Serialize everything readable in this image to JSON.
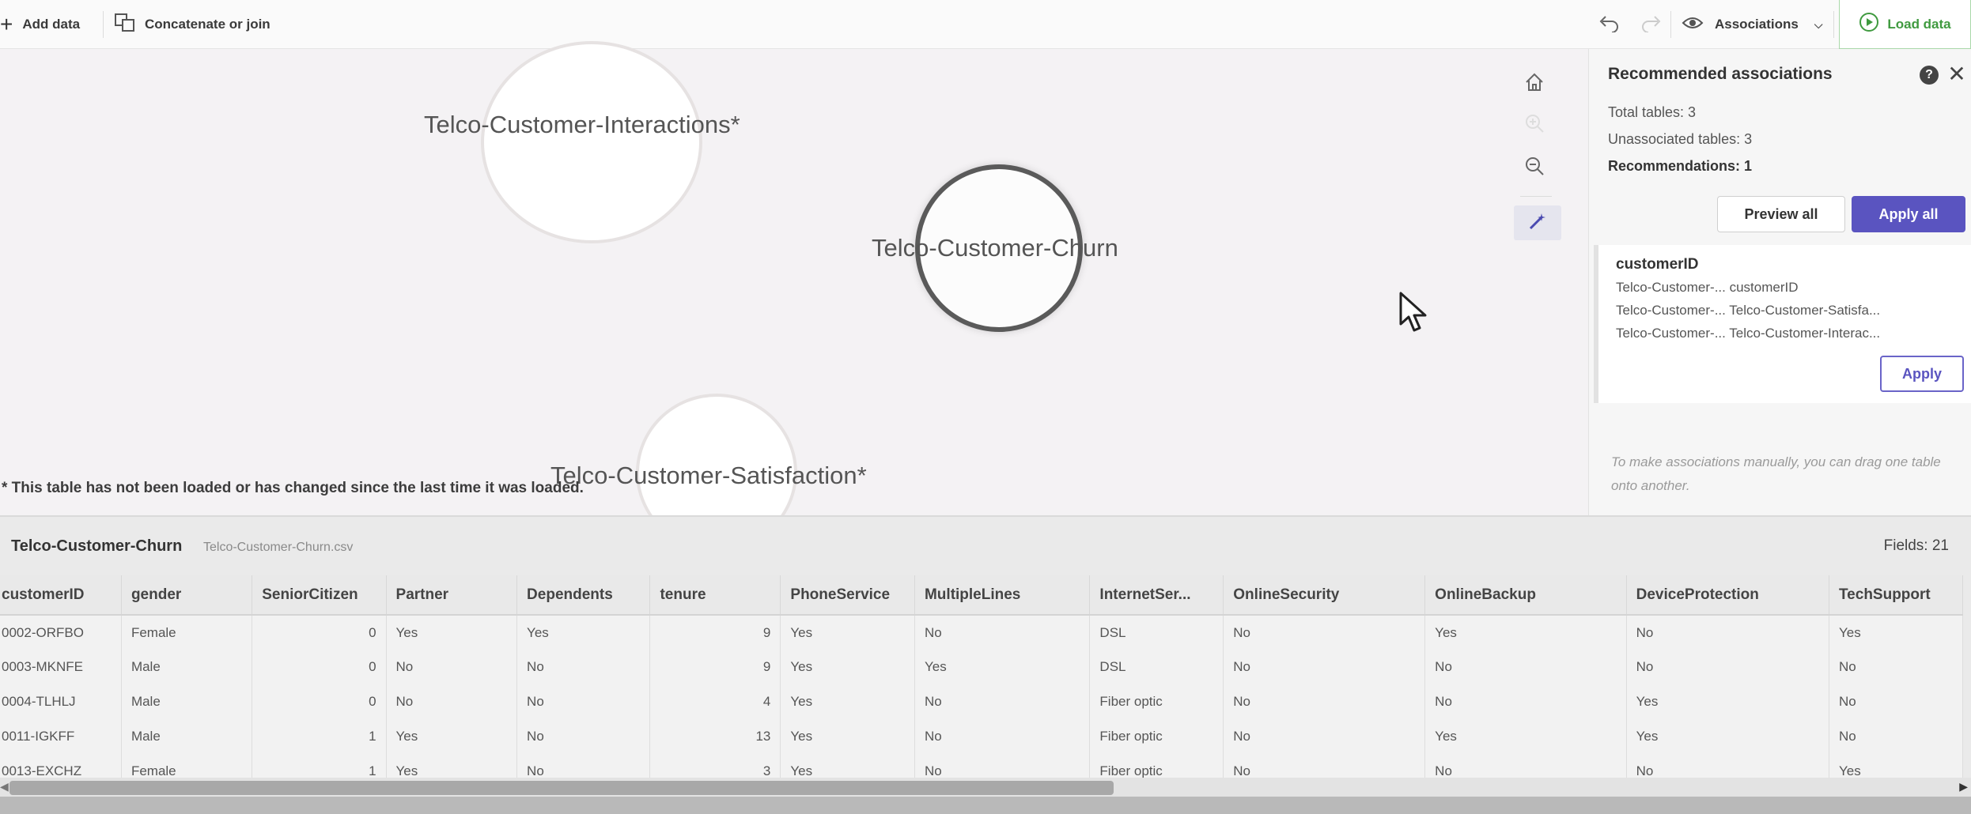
{
  "toolbar": {
    "add_data": "Add data",
    "concatenate": "Concatenate or join",
    "associations": "Associations",
    "load_data": "Load data"
  },
  "canvas": {
    "tables": [
      {
        "name": "Telco-Customer-Interactions*"
      },
      {
        "name": "Telco-Customer-Churn"
      },
      {
        "name": "Telco-Customer-Satisfaction*"
      }
    ],
    "footnote": "* This table has not been loaded or has changed since the last time it was loaded."
  },
  "panel": {
    "title": "Recommended associations",
    "total_tables": "Total tables: 3",
    "unassociated_tables": "Unassociated tables: 3",
    "recommendations": "Recommendations: 1",
    "preview_all": "Preview all",
    "apply_all": "Apply all",
    "recommendation": {
      "field": "customerID",
      "lines": [
        "Telco-Customer-... customerID",
        "Telco-Customer-... Telco-Customer-Satisfa...",
        "Telco-Customer-... Telco-Customer-Interac..."
      ],
      "apply": "Apply"
    },
    "hint": "To make associations manually, you can drag one table onto another."
  },
  "preview": {
    "table_name": "Telco-Customer-Churn",
    "file_name": "Telco-Customer-Churn.csv",
    "fields": "Fields: 21",
    "columns": [
      "customerID",
      "gender",
      "SeniorCitizen",
      "Partner",
      "Dependents",
      "tenure",
      "PhoneService",
      "MultipleLines",
      "InternetSer...",
      "OnlineSecurity",
      "OnlineBackup",
      "DeviceProtection",
      "TechSupport"
    ],
    "rows": [
      [
        "0002-ORFBO",
        "Female",
        "0",
        "Yes",
        "Yes",
        "9",
        "Yes",
        "No",
        "DSL",
        "No",
        "Yes",
        "No",
        "Yes"
      ],
      [
        "0003-MKNFE",
        "Male",
        "0",
        "No",
        "No",
        "9",
        "Yes",
        "Yes",
        "DSL",
        "No",
        "No",
        "No",
        "No"
      ],
      [
        "0004-TLHLJ",
        "Male",
        "0",
        "No",
        "No",
        "4",
        "Yes",
        "No",
        "Fiber optic",
        "No",
        "No",
        "Yes",
        "No"
      ],
      [
        "0011-IGKFF",
        "Male",
        "1",
        "Yes",
        "No",
        "13",
        "Yes",
        "No",
        "Fiber optic",
        "No",
        "Yes",
        "Yes",
        "No"
      ],
      [
        "0013-EXCHZ",
        "Female",
        "1",
        "Yes",
        "No",
        "3",
        "Yes",
        "No",
        "Fiber optic",
        "No",
        "No",
        "No",
        "Yes"
      ]
    ]
  }
}
